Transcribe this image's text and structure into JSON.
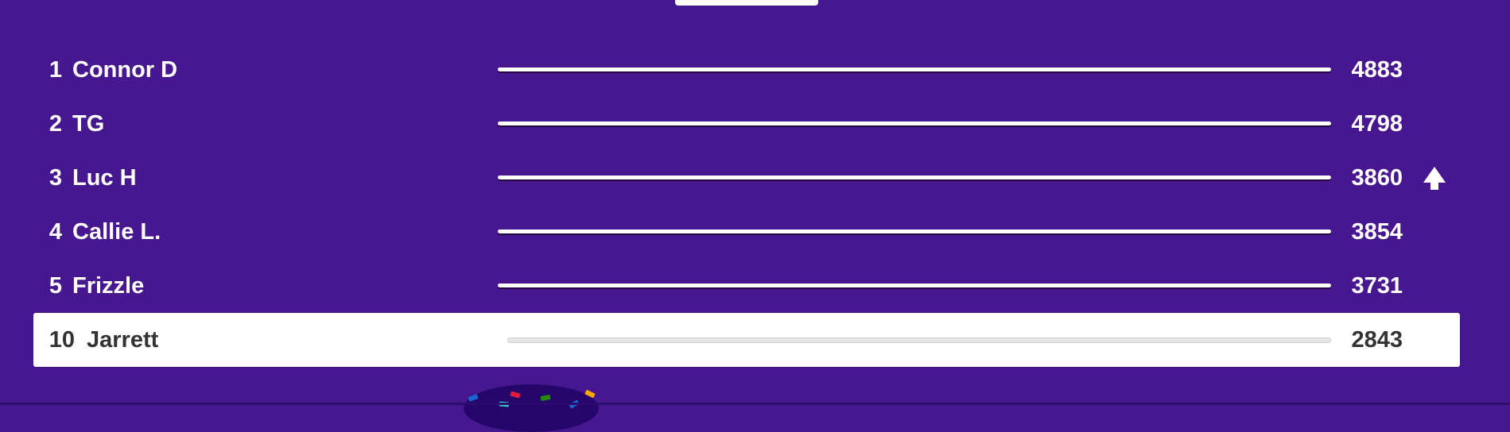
{
  "colors": {
    "background": "#46178f",
    "highlight_row_bg": "#ffffff",
    "row_text": "#ffffff",
    "highlight_text": "#333333"
  },
  "leaderboard": {
    "rows": [
      {
        "rank": "1",
        "name": "Connor D",
        "score": "4883",
        "progress": 1.0
      },
      {
        "rank": "2",
        "name": "TG",
        "score": "4798",
        "progress": 1.0
      },
      {
        "rank": "3",
        "name": "Luc H",
        "score": "3860",
        "progress": 1.0,
        "indicator": "up-arrow-icon"
      },
      {
        "rank": "4",
        "name": "Callie L.",
        "score": "3854",
        "progress": 1.0
      },
      {
        "rank": "5",
        "name": "Frizzle",
        "score": "3731",
        "progress": 1.0
      }
    ],
    "current_player": {
      "rank": "10",
      "name": "Jarrett",
      "score": "2843",
      "progress": 1.0
    }
  }
}
